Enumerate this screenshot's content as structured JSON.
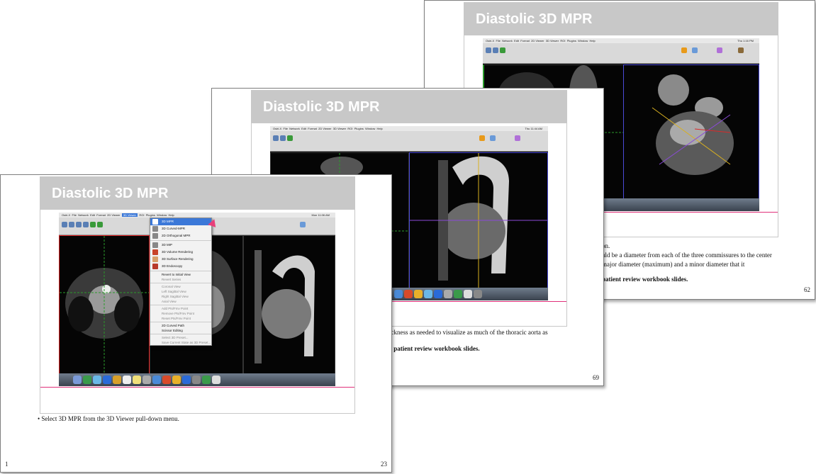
{
  "pages": [
    {
      "slide_title": "Diastolic 3D MPR",
      "notes_lines": [
        "on.",
        "uld be a diameter from each of the three commissures to the center",
        "major diameter (maximum) and a minor diameter that it"
      ],
      "bold_line": "patient review workbook slides.",
      "page_number": "62"
    },
    {
      "slide_title": "Diastolic 3D MPR",
      "notes_lines": [
        "ickness as needed to visualize as much of the thoracic aorta as"
      ],
      "bold_line": "e patient review workbook slides.",
      "page_number": "69"
    },
    {
      "slide_title": "Diastolic 3D MPR",
      "notes_lines": [
        "• Select 3D MPR from the 3D Viewer pull-down menu."
      ],
      "slide_number": "1",
      "page_number": "23"
    }
  ],
  "menu": {
    "bar_label": "3D Viewer",
    "items": [
      {
        "label": "3D MPR",
        "highlighted": true
      },
      {
        "label": "3D Curved-MPR"
      },
      {
        "label": "2D Orthogonal MPR"
      },
      {
        "label": "3D MIP"
      },
      {
        "label": "3D Volume Rendering"
      },
      {
        "label": "3D Surface Rendering"
      },
      {
        "label": "3D Endoscopy"
      }
    ],
    "lower_items": [
      "Revert to Initial View",
      "Revert Series",
      "Coronal View",
      "Left Sagittal View",
      "Right Sagittal View",
      "Axial View",
      "Add Pts/Fmv Point",
      "Remove Pts/Fmv Point",
      "Reset Pts/Fmv Point",
      "2D Curved Path",
      "Scissor Editing",
      "Select 3D Preset...",
      "Save Current State as 3D Preset..."
    ]
  },
  "app_menu": [
    "Osiri-X",
    "File",
    "Network",
    "Edit",
    "Format",
    "2D Viewer",
    "3D Viewer",
    "ROI",
    "Plugins",
    "Window",
    "Help"
  ],
  "clock": {
    "back": "Thu 1:16 PM",
    "middle": "Thu 11:44 AM",
    "front": "Mon 11:06 AM"
  },
  "colors": {
    "pink_rule": "#e0307a",
    "title_bar": "#c8c8c8",
    "menu_highlight": "#3b78d8"
  }
}
